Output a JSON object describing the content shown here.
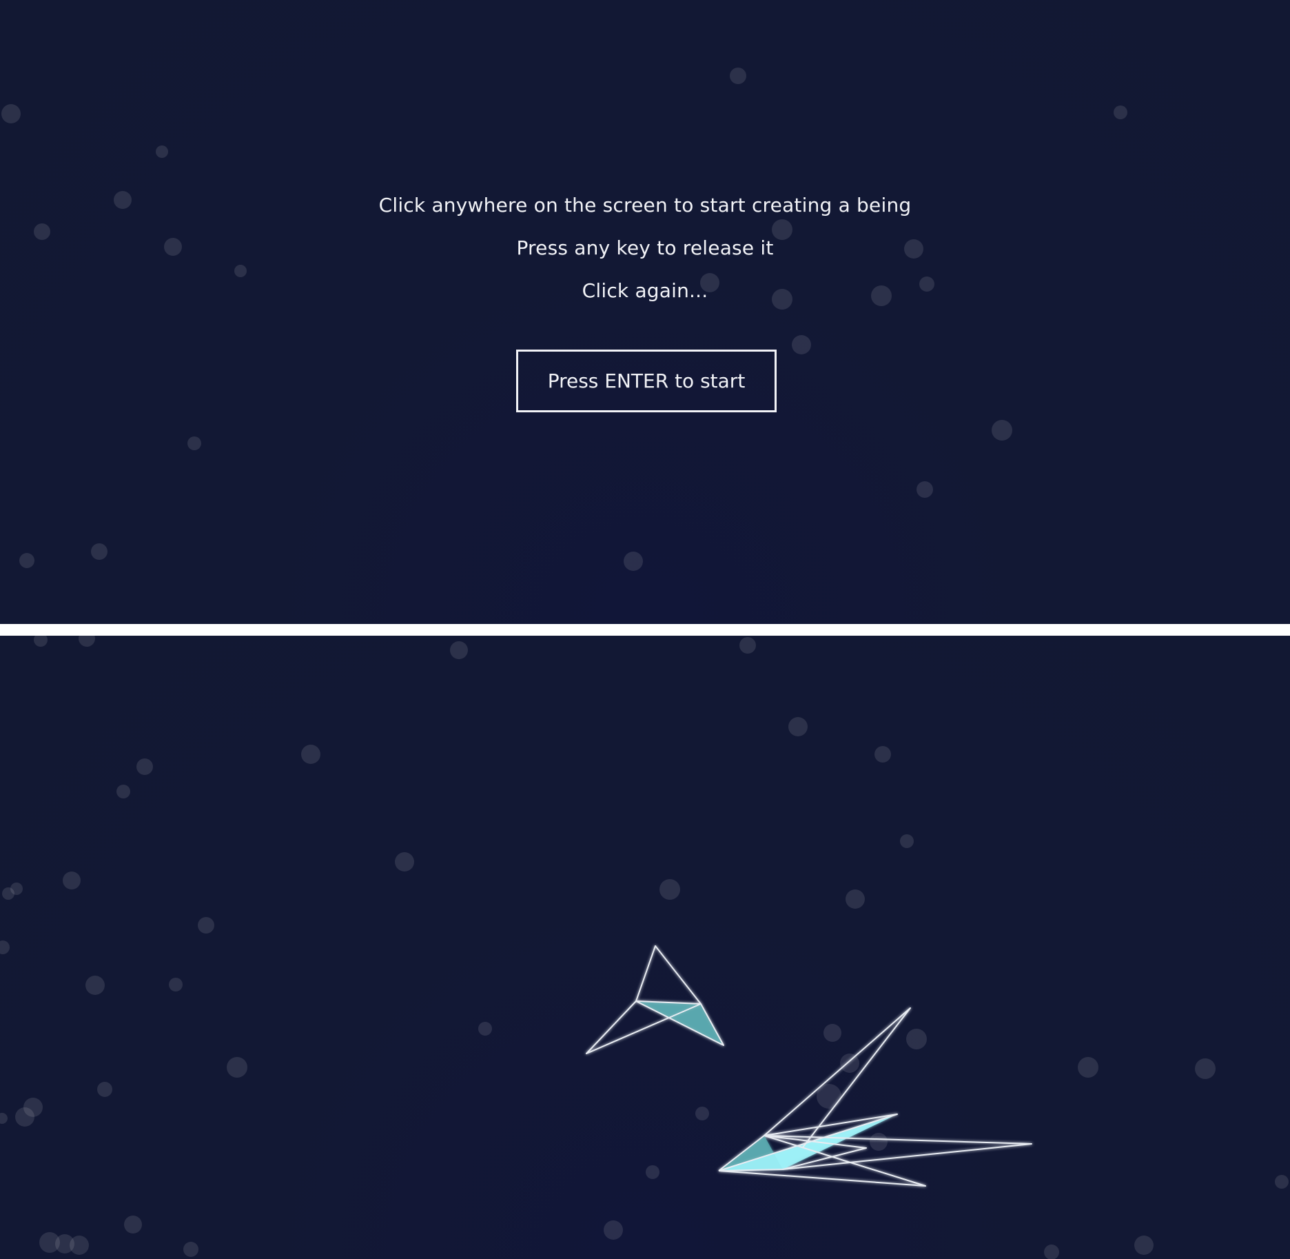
{
  "start_screen": {
    "instructions": [
      "Click anywhere on the screen to start creating a being",
      "Press any key to release it",
      "Click again..."
    ],
    "start_button_label": "Press ENTER to start"
  },
  "colors": {
    "background": "#121833",
    "text": "#f2f3f7",
    "particle": "#ffffff",
    "being_stroke": "#e8ecf2",
    "being_fill_teal": "#5aaab0",
    "being_fill_cyan": "#9ff2f8",
    "divider": "#ffffff"
  }
}
